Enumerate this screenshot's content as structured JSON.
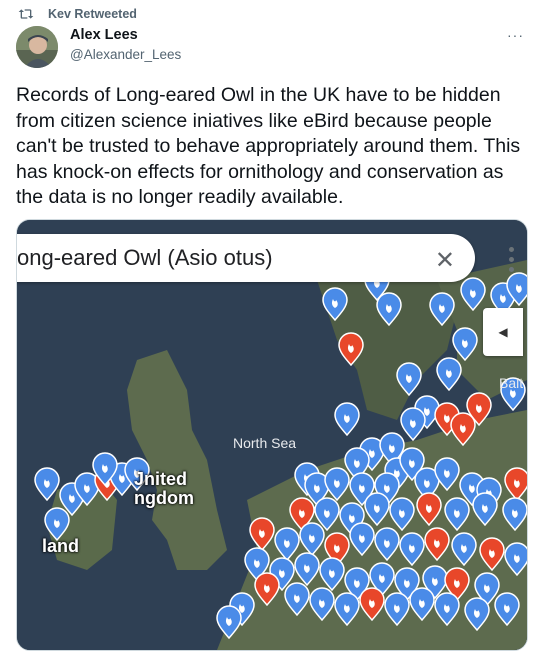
{
  "retweet": {
    "label": "Kev Retweeted"
  },
  "author": {
    "name": "Alex Lees",
    "handle": "@Alexander_Lees"
  },
  "more": {
    "label": "···"
  },
  "tweet": {
    "text": "Records of Long-eared Owl in the UK have to be hidden from citizen science iniatives like eBird because people can't be trusted to behave appropriately around them. This has knock-on effects for ornithology and conservation as the data is no longer readily available."
  },
  "media": {
    "search_query": "ong-eared Owl (Asio otus)",
    "clear_icon": "close-icon",
    "collapse_icon": "chevron-left-icon",
    "labels": {
      "sea": "North Sea",
      "country_top": "Jnited",
      "country_bottom": "ngdom",
      "ireland": "land",
      "baltic": "Balt"
    },
    "colors": {
      "pin_blue": "#4a8be8",
      "pin_red": "#e8472a",
      "sea": "#2f4054",
      "land": "#5d6b4e"
    }
  }
}
